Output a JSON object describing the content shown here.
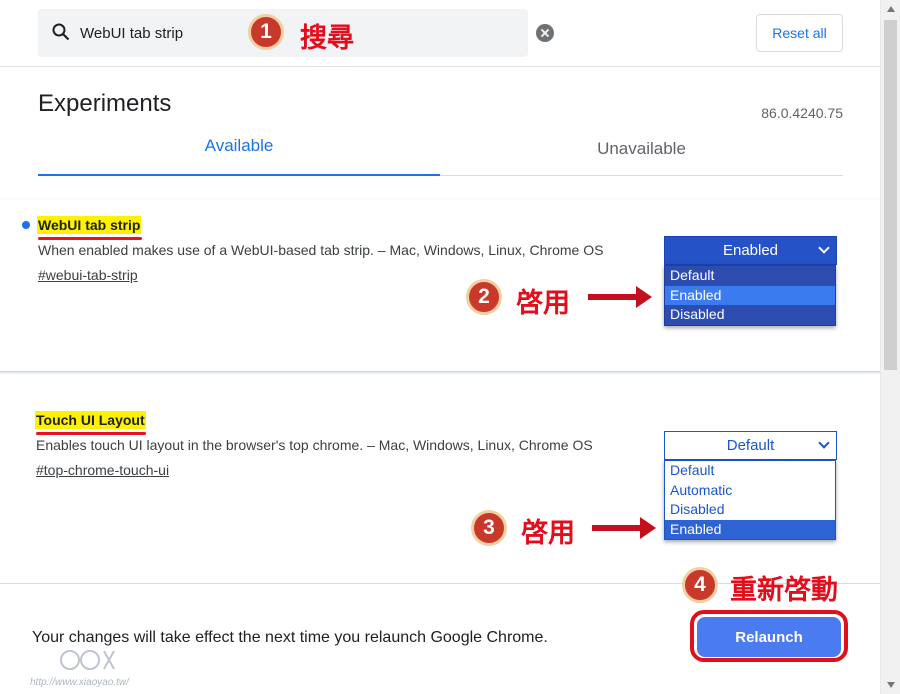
{
  "search": {
    "value": "WebUI tab strip"
  },
  "header": {
    "reset_label": "Reset all"
  },
  "main": {
    "title": "Experiments",
    "version": "86.0.4240.75",
    "tabs": [
      {
        "label": "Available"
      },
      {
        "label": "Unavailable"
      }
    ]
  },
  "experiments": [
    {
      "name": "WebUI tab strip",
      "description": "When enabled makes use of a WebUI-based tab strip. – Mac, Windows, Linux, Chrome OS",
      "link": "#webui-tab-strip",
      "selected": "Enabled",
      "options": [
        "Default",
        "Enabled",
        "Disabled"
      ]
    },
    {
      "name": "Touch UI Layout",
      "description": "Enables touch UI layout in the browser's top chrome. – Mac, Windows, Linux, Chrome OS",
      "link": "#top-chrome-touch-ui",
      "selected": "Default",
      "options": [
        "Default",
        "Automatic",
        "Disabled",
        "Enabled"
      ]
    }
  ],
  "footer": {
    "message": "Your changes will take effect the next time you relaunch Google Chrome.",
    "relaunch_label": "Relaunch"
  },
  "annotations": {
    "step1": {
      "number": "1",
      "text": "搜尋"
    },
    "step2": {
      "number": "2",
      "text": "啓用"
    },
    "step3": {
      "number": "3",
      "text": "啓用"
    },
    "step4": {
      "number": "4",
      "text": "重新啓動"
    }
  },
  "watermark": {
    "url": "http://www.xiaoyao.tw/"
  },
  "colors": {
    "accent": "#1a73e8",
    "annotation_red": "#e20e1b",
    "highlight": "#fff200"
  },
  "icons": {
    "search": "search-icon",
    "clear": "clear-icon",
    "chevron": "chevron-down-icon"
  }
}
